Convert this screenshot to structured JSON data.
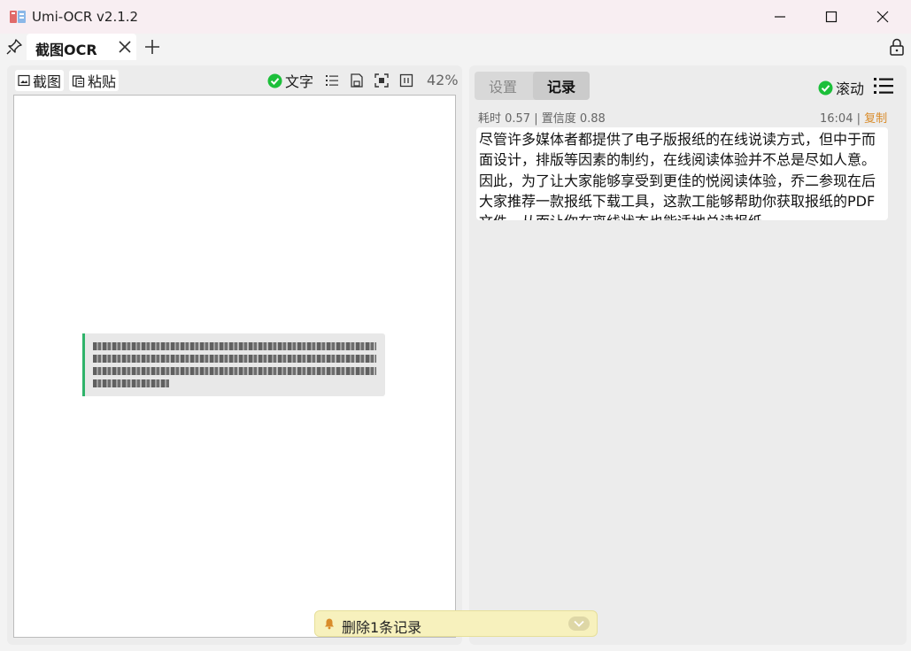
{
  "window": {
    "title": "Umi-OCR v2.1.2"
  },
  "tabs": [
    {
      "label": "截图OCR"
    }
  ],
  "left_toolbar": {
    "screenshot_label": "截图",
    "paste_label": "粘贴",
    "text_toggle_label": "文字",
    "zoom": "42%"
  },
  "right_panel": {
    "tabs": {
      "settings": "设置",
      "records": "记录"
    },
    "scroll_label": "滚动",
    "record": {
      "meta": "耗时 0.57 | 置信度 0.88",
      "time": "16:04",
      "separator": "|",
      "copy_label": "复制",
      "text": "尽管许多媒体者都提供了电子版报纸的在线说读方式，但中于而面设计，排版等因素的制约，在线阅读体验并不总是尽如人意。因此，为了让大家能够享受到更佳的悦阅读体验，乔二参现在后大家推荐一款报纸下载工具，这款工能够帮助你获取报纸的PDF文件，从而让你在离线状态也能适地兑读报纸"
    }
  },
  "toast": {
    "text": "删除1条记录"
  },
  "colors": {
    "accent_green": "#2fb36a",
    "check_green": "#1cbf3a",
    "copy_orange": "#d98c2b",
    "toast_bg": "#f7f1bd"
  }
}
